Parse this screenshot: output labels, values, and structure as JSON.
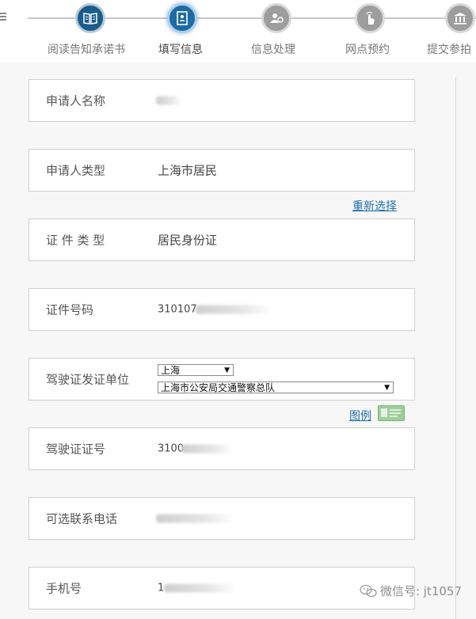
{
  "steps": [
    {
      "label": "阅读告知承诺书",
      "icon": "book-icon",
      "state": "done"
    },
    {
      "label": "填写信息",
      "icon": "form-icon",
      "state": "active"
    },
    {
      "label": "信息处理",
      "icon": "process-icon",
      "state": "future"
    },
    {
      "label": "网点预约",
      "icon": "touch-icon",
      "state": "future"
    },
    {
      "label": "提交参拍",
      "icon": "bank-icon",
      "state": "future"
    }
  ],
  "fields": {
    "applicant_name": {
      "label": "申请人名称",
      "value": ""
    },
    "applicant_type": {
      "label": "申请人类型",
      "value": "上海市居民"
    },
    "id_type": {
      "label": "证 件 类 型",
      "value": "居民身份证"
    },
    "id_number": {
      "label": "证件号码",
      "value": "310107"
    },
    "license_issuer": {
      "label": "驾驶证发证单位",
      "province_select": "上海",
      "agency_select": "上海市公安局交通警察总队"
    },
    "license_number": {
      "label": "驾驶证证号",
      "value": "3100"
    },
    "optional_phone": {
      "label": "可选联系电话",
      "value": ""
    },
    "mobile": {
      "label": "手机号",
      "value": "1"
    }
  },
  "links": {
    "reselect": "重新选择",
    "example": "图例"
  },
  "watermark": {
    "text": "微信号: jt1057"
  },
  "colors": {
    "step_done": "#1a5d8c",
    "step_active": "#1e6aa3",
    "step_future": "#9d9d9d",
    "link": "#1f6fae"
  }
}
